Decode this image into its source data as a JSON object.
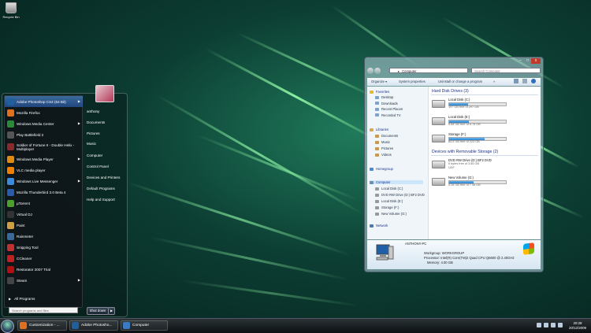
{
  "desktop": {
    "recycle_bin_label": "Recycle Bin"
  },
  "start_menu": {
    "programs": [
      {
        "label": "Adobe Photoshop CS4 (64 Bit)",
        "arrow": "▶",
        "color": "#1f5fa0",
        "selected": true
      },
      {
        "label": "Mozilla Firefox",
        "arrow": "",
        "color": "#e07020"
      },
      {
        "label": "Windows Media Center",
        "arrow": "▶",
        "color": "#2a8a3a"
      },
      {
        "label": "Play Battlefield 2",
        "arrow": "",
        "color": "#555555"
      },
      {
        "label": "Soldier of Fortune II - Double Helix - Multiplayer",
        "arrow": "",
        "color": "#8a2a2a"
      },
      {
        "label": "Windows Media Player",
        "arrow": "▶",
        "color": "#e08a10"
      },
      {
        "label": "VLC media player",
        "arrow": "",
        "color": "#f08000"
      },
      {
        "label": "Windows Live Messenger",
        "arrow": "▶",
        "color": "#3a8adf"
      },
      {
        "label": "Mozilla Thunderbird 3.0 Beta 4",
        "arrow": "",
        "color": "#2a5aaa"
      },
      {
        "label": "µTorrent",
        "arrow": "",
        "color": "#4aa02a"
      },
      {
        "label": "Virtual DJ",
        "arrow": "",
        "color": "#333333"
      },
      {
        "label": "Paint",
        "arrow": "",
        "color": "#d0a040"
      },
      {
        "label": "Rainmeter",
        "arrow": "",
        "color": "#3a6a9a"
      },
      {
        "label": "Snipping Tool",
        "arrow": "",
        "color": "#c03030"
      },
      {
        "label": "CCleaner",
        "arrow": "",
        "color": "#c02020"
      },
      {
        "label": "Restorator 2007 Trial",
        "arrow": "",
        "color": "#b01010"
      },
      {
        "label": "Steam",
        "arrow": "▶",
        "color": "#444444"
      }
    ],
    "all_programs": "All Programs",
    "search_placeholder": "Search programs and files",
    "right_items": [
      "anthony",
      "Documents",
      "Pictures",
      "Music",
      "Computer",
      "Control Panel",
      "Devices and Printers",
      "Default Programs",
      "Help and Support"
    ],
    "shutdown_label": "Shut down",
    "shutdown_arrow": "▶"
  },
  "explorer": {
    "controls": {
      "minimize": "–",
      "maximize": "□",
      "close": "x"
    },
    "address": "Computer",
    "address_arrow": "▸",
    "search_placeholder": "Search Computer",
    "commands": [
      "Organize ▾",
      "System properties",
      "Uninstall or change a program",
      "»"
    ],
    "nav": {
      "favorites": "Favorites",
      "favorites_items": [
        "Desktop",
        "Downloads",
        "Recent Places",
        "Recorded TV"
      ],
      "libraries": "Libraries",
      "libraries_items": [
        "Documents",
        "Music",
        "Pictures",
        "Videos"
      ],
      "homegroup": "Homegroup",
      "computer": "Computer",
      "computer_items": [
        "Local Disk (C:)",
        "DVD RW Drive (D:) BF2 DVD",
        "Local Disk (E:)",
        "Storage (F:)",
        "New Volume (G:)"
      ],
      "network": "Network"
    },
    "hard_disk_header": "Hard Disk Drives (3)",
    "hard_disks": [
      {
        "name": "Local Disk (C:)",
        "free": "197 GB free of 297 GB",
        "used_fraction": 0.34
      },
      {
        "name": "Local Disk (E:)",
        "free": "5.68 GB free of 8.76 GB",
        "used_fraction": 0.35
      },
      {
        "name": "Storage (F:)",
        "free": "84.5 GB free of 223 GB",
        "used_fraction": 0.62
      }
    ],
    "removable_header": "Devices with Removable Storage (2)",
    "removable": [
      {
        "name": "DVD RW Drive (D:) BF2 DVD",
        "free": "0 bytes free of 3.85 GB",
        "extra": "UDF"
      },
      {
        "name": "New Volume (G:)",
        "free": "4.28 GB free of 7.46 GB",
        "used_fraction": 0.43
      }
    ],
    "details": {
      "computer_name": "ANTHONY-PC",
      "workgroup": "Workgroup: WORKGROUP",
      "processor": "Processor: Intel(R) Core(TM)2 Quad CPU    Q6600 @ 2.40GHz",
      "memory": "Memory: 4.00 GB"
    }
  },
  "taskbar": {
    "buttons": [
      {
        "label": "Customization - ...",
        "color": "#e07020"
      },
      {
        "label": "Adobe Photosho...",
        "color": "#1f5fa0"
      },
      {
        "label": "Computer",
        "color": "#3a7ac0"
      }
    ],
    "time": "20:28",
    "date": "20/12/2009"
  }
}
